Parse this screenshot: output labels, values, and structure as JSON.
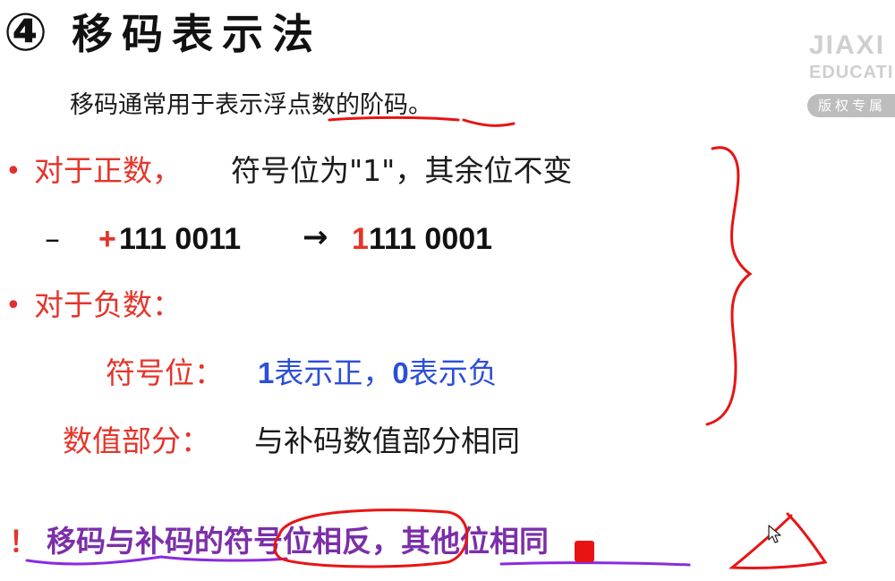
{
  "title": {
    "number": "④",
    "text": "移码表示法"
  },
  "watermark": {
    "line1": "JIAXI",
    "line2": "EDUCATI",
    "badge": "版权专属"
  },
  "intro": "移码通常用于表示浮点数的阶码。",
  "bullet1": {
    "head": "对于正数，",
    "rest": "符号位为\"1\"，其余位不变"
  },
  "example": {
    "dash": "–",
    "before_sign": "+",
    "before_value": "111 0011",
    "arrow": "→",
    "after_sign_bit": "1",
    "after_rest": "111 0001"
  },
  "bullet2": {
    "head": "对于负数："
  },
  "sign_bit": {
    "label": "符号位：",
    "one": "1",
    "one_text": "表示正，",
    "zero": "0",
    "zero_text": "表示负"
  },
  "numeric_part": {
    "label": "数值部分：",
    "value": "与补码数值部分相同"
  },
  "note": {
    "mark": "！",
    "text": "移码与补码的符号位相反，其他位相同"
  },
  "colors": {
    "emphasis_red": "#e5342a",
    "blue": "#2b4fd8",
    "purple": "#7b2fa8",
    "pen_red": "#e81414",
    "pen_purple": "#8a2be2"
  },
  "icons": {
    "cursor": "mouse-pointer-icon",
    "bullet": "bullet-dot-icon"
  }
}
